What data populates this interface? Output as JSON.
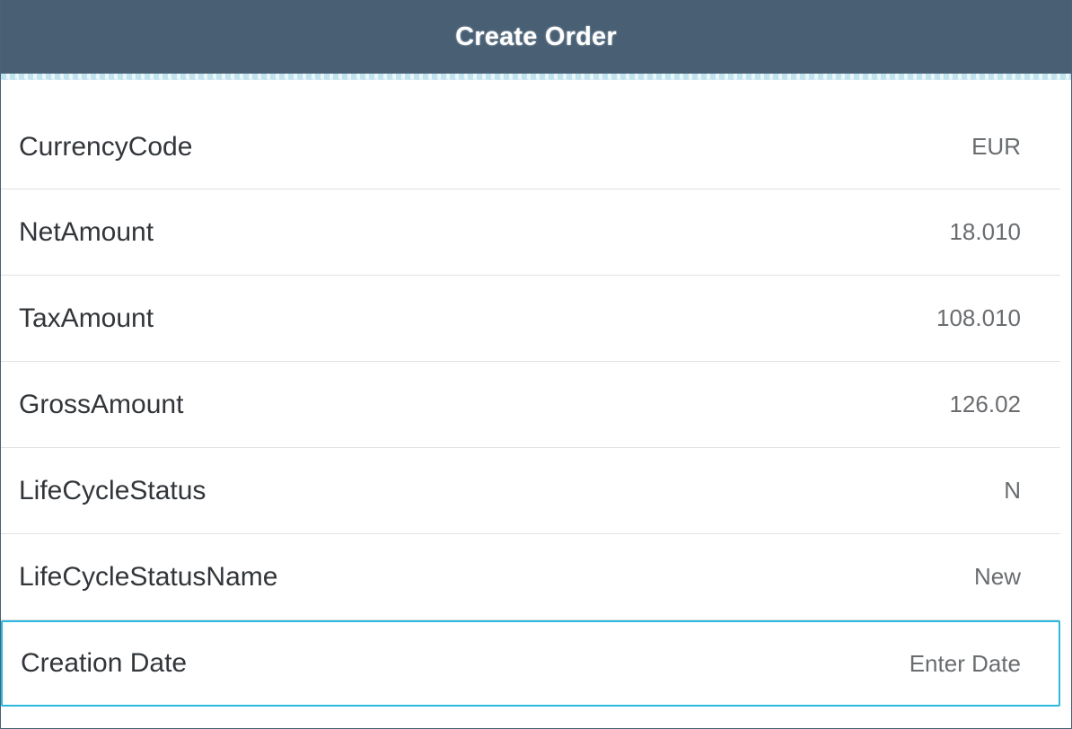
{
  "header": {
    "title": "Create Order"
  },
  "fields": [
    {
      "label": "CurrencyCode",
      "value": "EUR"
    },
    {
      "label": "NetAmount",
      "value": "18.010"
    },
    {
      "label": "TaxAmount",
      "value": "108.010"
    },
    {
      "label": "GrossAmount",
      "value": "126.02"
    },
    {
      "label": "LifeCycleStatus",
      "value": "N"
    },
    {
      "label": "LifeCycleStatusName",
      "value": "New"
    }
  ],
  "creation_date": {
    "label": "Creation Date",
    "placeholder": "Enter Date"
  },
  "colors": {
    "header_bg": "#485f74",
    "focus_border": "#2bb7e0",
    "text_primary": "#32363a",
    "text_secondary": "#6a6d70"
  }
}
